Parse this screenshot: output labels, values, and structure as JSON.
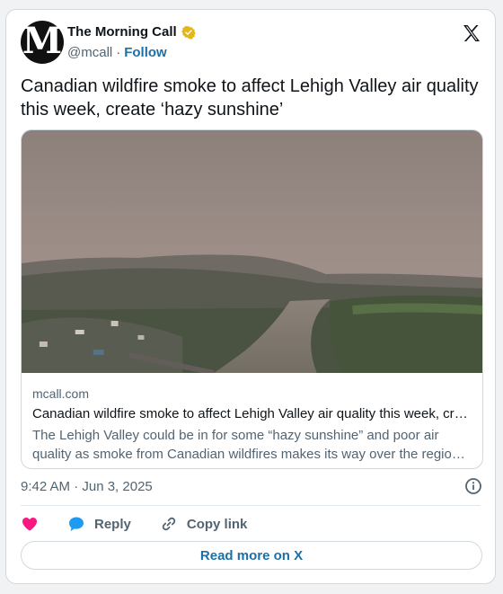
{
  "author": {
    "display_name": "The Morning Call",
    "avatar_letter": "M",
    "handle": "@mcall",
    "separator": "·",
    "follow_label": "Follow"
  },
  "tweet": {
    "text": "Canadian wildfire smoke to affect Lehigh Valley air quality this week, create ‘hazy sunshine’"
  },
  "link_card": {
    "domain": "mcall.com",
    "title": "Canadian wildfire smoke to affect Lehigh Valley air quality this week, create ‘hazy sunshine’",
    "description": "The Lehigh Valley could be in for some “hazy sunshine” and poor air quality as smoke from Canadian wildfires makes its way over the region this week."
  },
  "meta": {
    "timestamp": "9:42 AM · Jun 3, 2025"
  },
  "actions": {
    "reply_label": "Reply",
    "copy_label": "Copy link",
    "read_more_label": "Read more on X"
  },
  "colors": {
    "accent": "#1d6fa5",
    "like": "#f91880",
    "reply": "#1d9bf0",
    "secondary_text": "#536471",
    "border": "#cfd9de"
  },
  "icons": [
    "verified-badge-icon",
    "x-logo-icon",
    "info-icon",
    "heart-icon",
    "reply-bubble-icon",
    "link-icon"
  ]
}
